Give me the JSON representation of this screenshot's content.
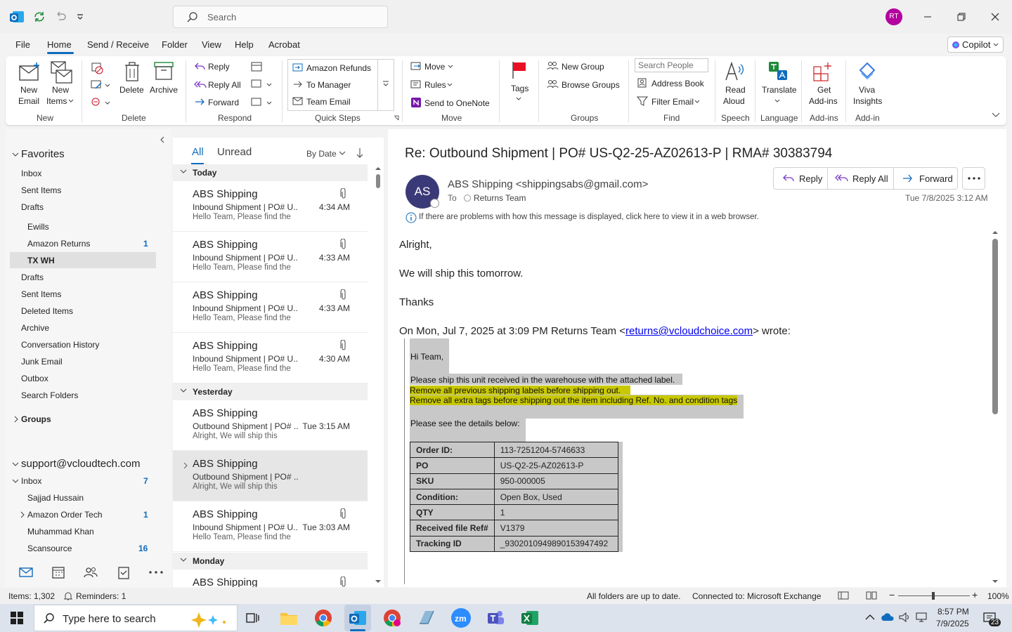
{
  "titlebar": {
    "search_placeholder": "Search",
    "avatar": "RT"
  },
  "menu": {
    "tabs": [
      "File",
      "Home",
      "Send / Receive",
      "Folder",
      "View",
      "Help",
      "Acrobat"
    ],
    "copilot": "Copilot"
  },
  "ribbon": {
    "new_email": [
      "New",
      "Email"
    ],
    "new_items": [
      "New",
      "Items"
    ],
    "delete": "Delete",
    "archive": "Archive",
    "reply": "Reply",
    "reply_all": "Reply All",
    "forward": "Forward",
    "quick_steps": [
      "Amazon Refunds",
      "To Manager",
      "Team Email"
    ],
    "move": "Move",
    "rules": "Rules",
    "onenote": "Send to OneNote",
    "tags": "Tags",
    "new_group": "New Group",
    "browse_groups": "Browse Groups",
    "search_people": "Search People",
    "address_book": "Address Book",
    "filter_email": "Filter Email",
    "read_aloud": [
      "Read",
      "Aloud"
    ],
    "translate": "Translate",
    "get_addins": [
      "Get",
      "Add-ins"
    ],
    "viva": [
      "Viva",
      "Insights"
    ],
    "groups": [
      "New",
      "Delete",
      "Respond",
      "Quick Steps",
      "Move",
      "Groups",
      "Find",
      "Speech",
      "Language",
      "Add-ins",
      "Add-in"
    ]
  },
  "folders": {
    "favorites": "Favorites",
    "fav_items": [
      "Inbox",
      "Sent Items",
      "Drafts"
    ],
    "sub_items": [
      {
        "label": "Ewills",
        "count": ""
      },
      {
        "label": "Amazon Returns",
        "count": "1"
      },
      {
        "label": "TX WH",
        "count": ""
      }
    ],
    "main_items": [
      "Drafts",
      "Sent Items",
      "Deleted Items",
      "Archive",
      "Conversation History",
      "Junk Email",
      "Outbox",
      "Search Folders"
    ],
    "groups": "Groups",
    "account": "support@vcloudtech.com",
    "inbox": {
      "label": "Inbox",
      "count": "7"
    },
    "inbox_sub": [
      {
        "label": "Sajjad Hussain",
        "count": ""
      },
      {
        "label": "Amazon Order Tech",
        "count": "1"
      },
      {
        "label": "Muhammad Khan",
        "count": ""
      },
      {
        "label": "Scansource",
        "count": "16"
      }
    ]
  },
  "list": {
    "filter_all": "All",
    "filter_unread": "Unread",
    "sort": "By Date",
    "groups": [
      "Today",
      "Yesterday",
      "Monday"
    ],
    "items": [
      {
        "sender": "ABS Shipping",
        "subject": "Inbound Shipment | PO# U...",
        "time": "4:34 AM",
        "preview": "Hello Team,  Please find the"
      },
      {
        "sender": "ABS Shipping",
        "subject": "Inbound Shipment | PO# U...",
        "time": "4:33 AM",
        "preview": "Hello Team,  Please find the"
      },
      {
        "sender": "ABS Shipping",
        "subject": "Inbound Shipment | PO# U...",
        "time": "4:33 AM",
        "preview": "Hello Team,  Please find the"
      },
      {
        "sender": "ABS Shipping",
        "subject": "Inbound Shipment | PO# U...",
        "time": "4:30 AM",
        "preview": "Hello Team,  Please find the"
      },
      {
        "sender": "ABS Shipping",
        "subject": "Outbound Shipment | PO# ...",
        "time": "Tue 3:15 AM",
        "preview": "Alright,  We will ship this"
      },
      {
        "sender": "ABS Shipping",
        "subject": "Outbound Shipment | PO# ...",
        "time": "",
        "preview": "Alright,  We will ship this"
      },
      {
        "sender": "ABS Shipping",
        "subject": "Inbound Shipment | PO# U...",
        "time": "Tue 3:03 AM",
        "preview": "Hello Team,  Please find the"
      },
      {
        "sender": "ABS Shipping",
        "subject": "",
        "time": "",
        "preview": ""
      }
    ]
  },
  "message": {
    "subject": "Re: Outbound Shipment | PO# US-Q2-25-AZ02613-P | RMA# 30383794",
    "avatar": "AS",
    "from": "ABS Shipping <shippingsabs@gmail.com>",
    "to_label": "To",
    "to": "Returns Team",
    "date": "Tue 7/8/2025 3:12 AM",
    "info": "If there are problems with how this message is displayed, click here to view it in a web browser.",
    "actions": {
      "reply": "Reply",
      "reply_all": "Reply All",
      "forward": "Forward"
    },
    "body": [
      "Alright,",
      "We will ship this tomorrow.",
      "Thanks"
    ],
    "quote_header_pre": "On Mon, Jul 7, 2025 at 3:09 PM Returns Team <",
    "quote_email": "returns@vcloudchoice.com",
    "quote_header_post": "> wrote:",
    "quoted": {
      "greeting": "Hi Team,",
      "line1": "Please ship this unit received in the warehouse with the attached label.",
      "line2": "Remove all previous shipping labels before shipping out.",
      "line3": "Remove all extra tags before shipping out the item including Ref. No. and condition tags",
      "line4": "Please see the details below:",
      "table": [
        {
          "k": "Order ID:",
          "v": "113-7251204-5746633"
        },
        {
          "k": "PO",
          "v": "US-Q2-25-AZ02613-P"
        },
        {
          "k": "SKU",
          "v": "950-000005"
        },
        {
          "k": "Condition:",
          "v": "Open Box, Used"
        },
        {
          "k": "QTY",
          "v": "1"
        },
        {
          "k": "Received file Ref#",
          "v": "V1379"
        },
        {
          "k": "Tracking ID",
          "v": "_9302010949890153947492"
        }
      ]
    }
  },
  "status": {
    "items": "Items: 1,302",
    "reminders": "Reminders: 1",
    "sync": "All folders are up to date.",
    "connected": "Connected to: Microsoft Exchange",
    "zoom": "100%"
  },
  "taskbar": {
    "search": "Type here to search",
    "time": "8:57 PM",
    "date": "7/9/2025",
    "notif": "23"
  }
}
